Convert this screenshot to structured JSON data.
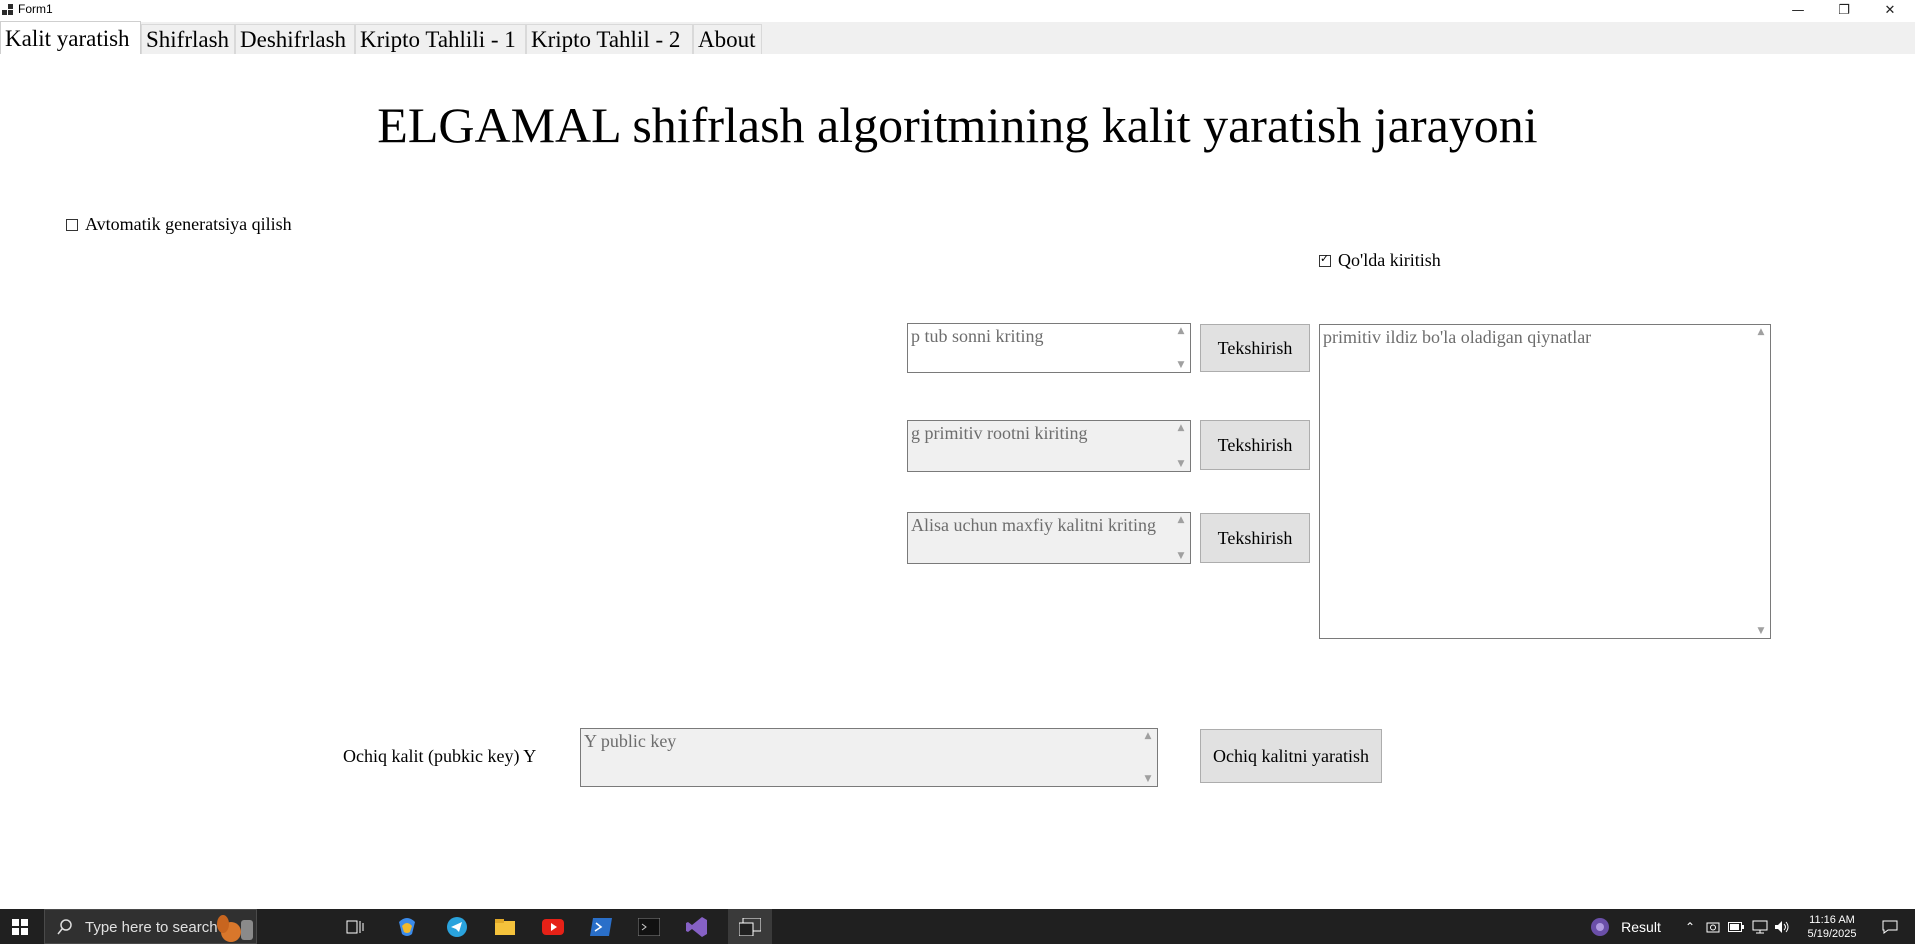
{
  "window": {
    "title": "Form1",
    "minimize": "—",
    "restore": "❐",
    "close": "✕"
  },
  "tabs": [
    {
      "label": "Kalit yaratish"
    },
    {
      "label": "Shifrlash"
    },
    {
      "label": "Deshifrlash"
    },
    {
      "label": "Kripto Tahlili - 1"
    },
    {
      "label": "Kripto Tahlil - 2"
    },
    {
      "label": "About"
    }
  ],
  "main": {
    "heading": "ELGAMAL shifrlash algoritmining kalit yaratish jarayoni",
    "auto_checkbox": {
      "label": "Avtomatik generatsiya qilish",
      "checked": false
    },
    "manual_checkbox": {
      "label": "Qo'lda kiritish",
      "checked": true
    },
    "p_input": {
      "placeholder": "p tub sonni kriting"
    },
    "g_input": {
      "placeholder": "g primitiv rootni kiriting"
    },
    "x_input": {
      "placeholder": "Alisa uchun maxfiy kalitni kriting"
    },
    "check_button_label": "Tekshirish",
    "roots_output": {
      "placeholder": "primitiv ildiz bo'la oladigan qiynatlar"
    },
    "public_key_label": "Ochiq kalit (pubkic key) Y",
    "public_key_input": {
      "placeholder": "Y public key"
    },
    "generate_button_label": "Ochiq kalitni yaratish"
  },
  "taskbar": {
    "search_placeholder": "Type here to search",
    "tray_app_label": "Result",
    "time": "11:16 AM",
    "date": "5/19/2025"
  },
  "colors": {
    "button_bg": "#e1e1e1",
    "disabled_bg": "#f0f0f0",
    "taskbar_bg": "#202020"
  }
}
